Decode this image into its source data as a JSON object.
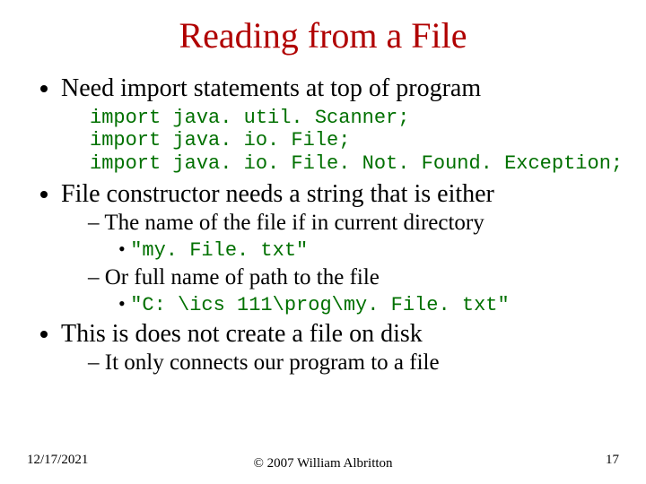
{
  "title": "Reading from a File",
  "bullets": {
    "b1": "Need import statements at top of program",
    "code1_l1": "import java. util. Scanner;",
    "code1_l2": "import java. io. File;",
    "code1_l3": "import java. io. File. Not. Found. Exception;",
    "b2": "File constructor needs a string that is either",
    "b2_s1": "The name of the file if in current directory",
    "b2_s1_c": "\"my. File. txt\"",
    "b2_s2": "Or full name of path to the file",
    "b2_s2_c": "\"C: \\ics 111\\prog\\my. File. txt\"",
    "b3": "This is does not create a file on disk",
    "b3_s1": "It only connects our program to a file"
  },
  "footer": {
    "date": "12/17/2021",
    "copyright": "© 2007 William Albritton",
    "page": "17"
  }
}
